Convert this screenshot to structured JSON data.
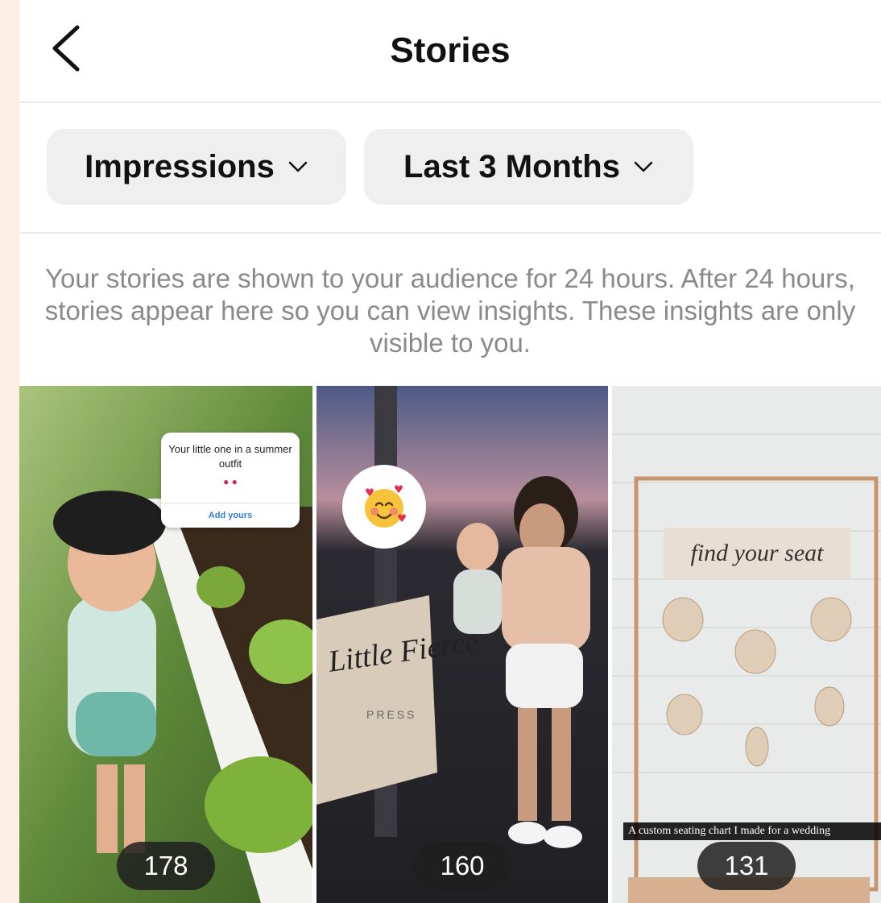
{
  "header": {
    "title": "Stories"
  },
  "filters": {
    "metric_label": "Impressions",
    "period_label": "Last 3 Months"
  },
  "info_text": "Your stories are shown to your audience for 24 hours. After 24 hours, stories appear here so you can view insights. These insights are only visible to you.",
  "stories": [
    {
      "count": "178",
      "sticker_question": "Your little one in a summer outfit",
      "sticker_action": "Add yours"
    },
    {
      "count": "160",
      "brand_text": "Little Fierce",
      "brand_sub": "PRESS"
    },
    {
      "count": "131",
      "sign_text": "find your seat",
      "caption": "A custom seating chart I made for a wedding"
    }
  ],
  "colors": {
    "page_background": "#fdeee3",
    "pill_background": "#efefef",
    "count_badge": "#1e1e1e",
    "muted_text": "#8a8a8a"
  },
  "icons": [
    "back-chevron-icon",
    "chevron-down-icon",
    "smiling-face-with-hearts-emoji"
  ]
}
